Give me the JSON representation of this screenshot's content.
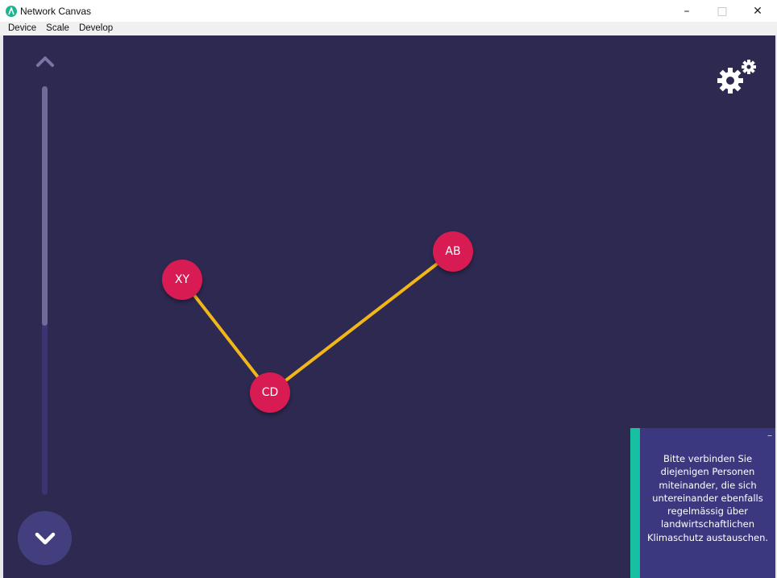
{
  "window": {
    "title": "Network Canvas",
    "controls": {
      "minimize": "–",
      "maximize": "□",
      "close": "✕"
    }
  },
  "menu": {
    "items": [
      {
        "label": "Device"
      },
      {
        "label": "Scale"
      },
      {
        "label": "Develop"
      }
    ]
  },
  "timeline": {
    "up_icon": "chevron-up-icon",
    "down_icon": "chevron-down-icon",
    "progress": 0.59
  },
  "settings": {
    "icon": "gears-icon"
  },
  "network": {
    "nodes": [
      {
        "id": "XY",
        "label": "XY"
      },
      {
        "id": "AB",
        "label": "AB"
      },
      {
        "id": "CD",
        "label": "CD"
      }
    ],
    "edges": [
      {
        "from": "XY",
        "to": "CD"
      },
      {
        "from": "CD",
        "to": "AB"
      }
    ]
  },
  "prompt": {
    "minimize_label": "–",
    "text": "Bitte verbinden Sie diejenigen Personen miteinander, die sich untereinander ebenfalls regelmässig über landwirtschaftlichen Klimaschutz austauschen."
  },
  "colors": {
    "canvas_bg": "#2d2951",
    "node": "#d81b52",
    "edge": "#f2b619",
    "prompt_bg": "#3c3880",
    "prompt_accent": "#17c0a0",
    "app_icon": "#1db58f"
  }
}
